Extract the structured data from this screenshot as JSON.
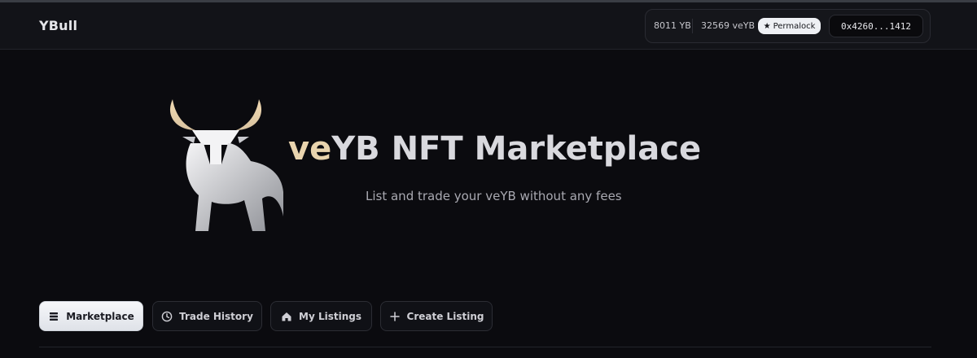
{
  "app": {
    "brand": "YBull"
  },
  "header": {
    "yb_balance": "8011 YB",
    "veyb_balance": "32569 veYB",
    "permalock_label": "Permalock",
    "wallet_address": "0x4260...1412"
  },
  "hero": {
    "title_accent": "ve",
    "title_rest": "YB NFT Marketplace",
    "subtitle": "List and trade your veYB without any fees"
  },
  "tabs": [
    {
      "label": "Marketplace",
      "icon": "list-icon",
      "active": true
    },
    {
      "label": "Trade History",
      "icon": "clock-icon",
      "active": false
    },
    {
      "label": "My Listings",
      "icon": "home-icon",
      "active": false
    },
    {
      "label": "Create Listing",
      "icon": "plus-icon",
      "active": false
    }
  ],
  "colors": {
    "background": "#0b0b0f",
    "accent_gold": "#e9d4ae",
    "active_tab": "#eef0f4"
  }
}
